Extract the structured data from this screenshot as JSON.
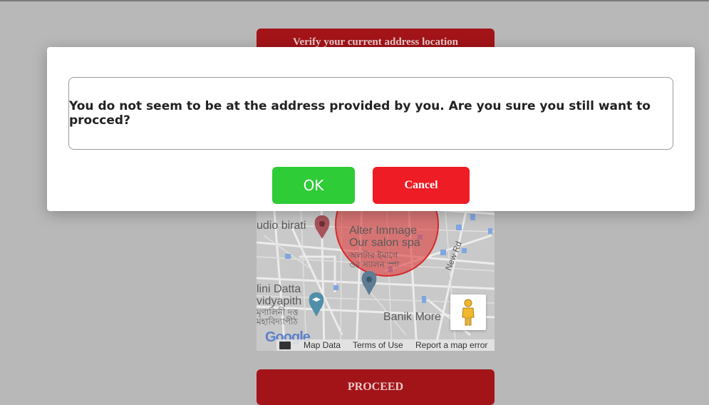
{
  "page": {
    "verify_label": "Verify your current address location",
    "proceed_label": "PROCEED"
  },
  "map": {
    "labels": {
      "studio": "udio birati",
      "alter_line1": "Alter Immage",
      "alter_line2": "Our salon spa",
      "alter_line3": "অলটার ইমাগে",
      "alter_line4": "ওর স্যালন স্পা",
      "mrinalini_line1": "lini Datta",
      "mrinalini_line2": "vidyapith",
      "mrinalini_line3": "মৃণালিনী দত্ত",
      "mrinalini_line4": "মহাবিদ্যাপীঠ",
      "banik": "Banik More",
      "new_rd": "New Rd"
    },
    "google_logo": "Google",
    "footer": {
      "map_data": "Map Data",
      "terms": "Terms of Use",
      "report": "Report a map error"
    },
    "icons": [
      "keyboard-icon",
      "pegman-icon",
      "location-pin-icon"
    ],
    "radius_color": "#e03a3a"
  },
  "modal": {
    "message": "You do not seem to be at the address provided by you. Are you sure you still want to procced?",
    "ok_label": "OK",
    "cancel_label": "Cancel"
  },
  "colors": {
    "brand_red": "#a31419",
    "ok_green": "#2ecc36",
    "cancel_red": "#ee1c24",
    "overlay": "#b8b8b8"
  }
}
